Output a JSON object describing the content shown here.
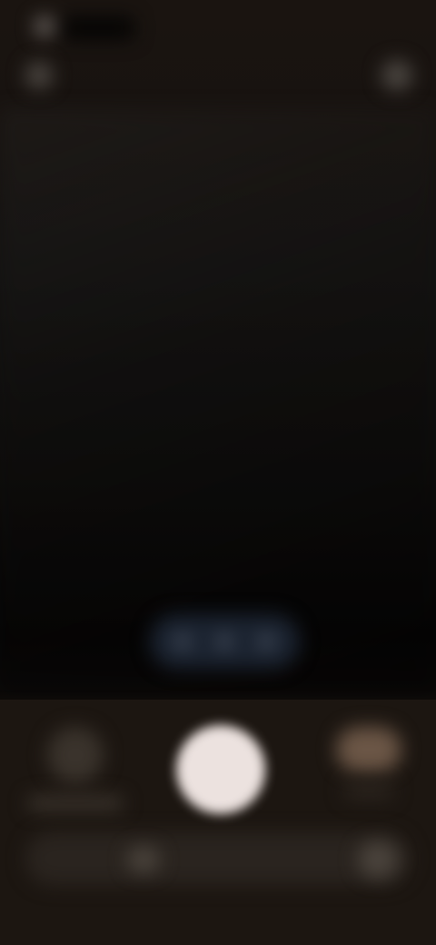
{
  "app": {
    "screen": "camera"
  },
  "colors": {
    "background_top": "#1a1410",
    "background_mid": "#0d0c0b",
    "panel": "#1c1611",
    "shutter": "#ece2df",
    "zoom_pill": "#1b2330",
    "switch_thumb": "#6b5646"
  },
  "icons": {
    "status": "status-dot-icon",
    "top_left": "flash-icon",
    "top_right": "settings-icon",
    "gallery": "gallery-thumbnail-icon",
    "switch": "switch-camera-icon"
  }
}
